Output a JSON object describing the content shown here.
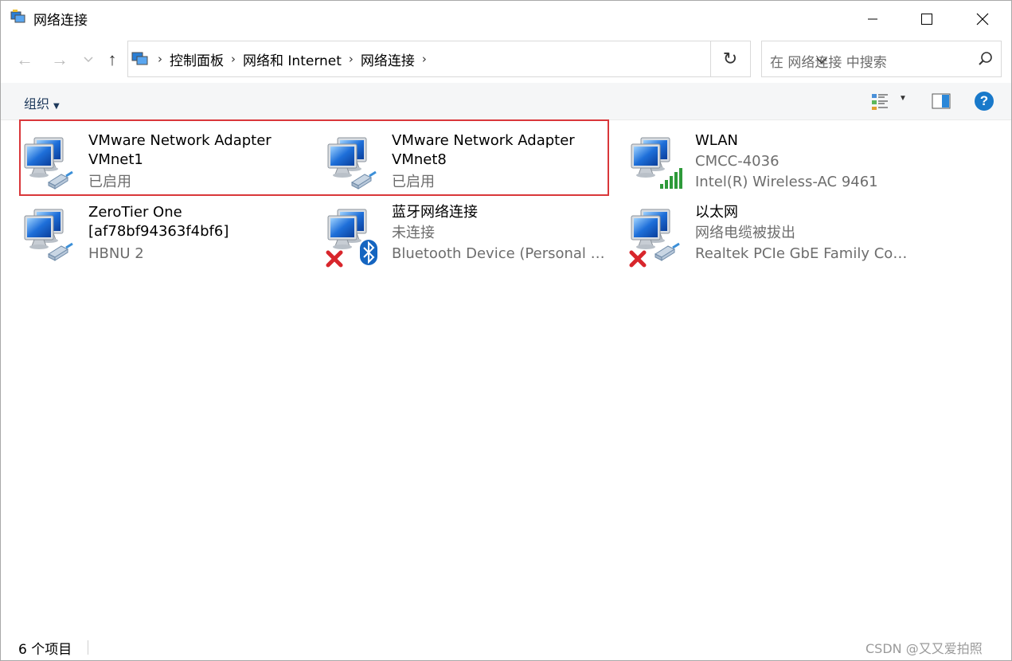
{
  "window": {
    "title": "网络连接"
  },
  "nav": {
    "back_glyph": "←",
    "forward_glyph": "→",
    "up_glyph": "↑"
  },
  "address": {
    "crumbs": [
      "控制面板",
      "网络和 Internet",
      "网络连接"
    ]
  },
  "search": {
    "placeholder": "在 网络连接 中搜索"
  },
  "toolbar": {
    "organize_label": "组织"
  },
  "items": [
    {
      "name": "VMware Network Adapter VMnet1",
      "status": "已启用",
      "device": "",
      "icon": "network-adapter-icon"
    },
    {
      "name": "VMware Network Adapter VMnet8",
      "status": "已启用",
      "device": "",
      "icon": "network-adapter-icon"
    },
    {
      "name": "WLAN",
      "status": "CMCC-4036",
      "device": "Intel(R) Wireless-AC 9461",
      "icon": "wifi-adapter-icon"
    },
    {
      "name": "ZeroTier One [af78bf94363f4bf6]",
      "status": "HBNU 2",
      "device": "",
      "icon": "network-adapter-icon"
    },
    {
      "name": "蓝牙网络连接",
      "status": "未连接",
      "device": "Bluetooth Device (Personal Area Network)",
      "icon": "bluetooth-adapter-disconnected-icon"
    },
    {
      "name": "以太网",
      "status": "网络电缆被拔出",
      "device": "Realtek PCIe GbE Family Controller",
      "icon": "ethernet-adapter-disconnected-icon"
    }
  ],
  "statusbar": {
    "count": "6 个项目"
  },
  "watermark": "CSDN @又又爱拍照",
  "colors": {
    "highlight_border": "#d9373a",
    "accent": "#1979ca",
    "secondary_text": "#6d6d6d"
  }
}
